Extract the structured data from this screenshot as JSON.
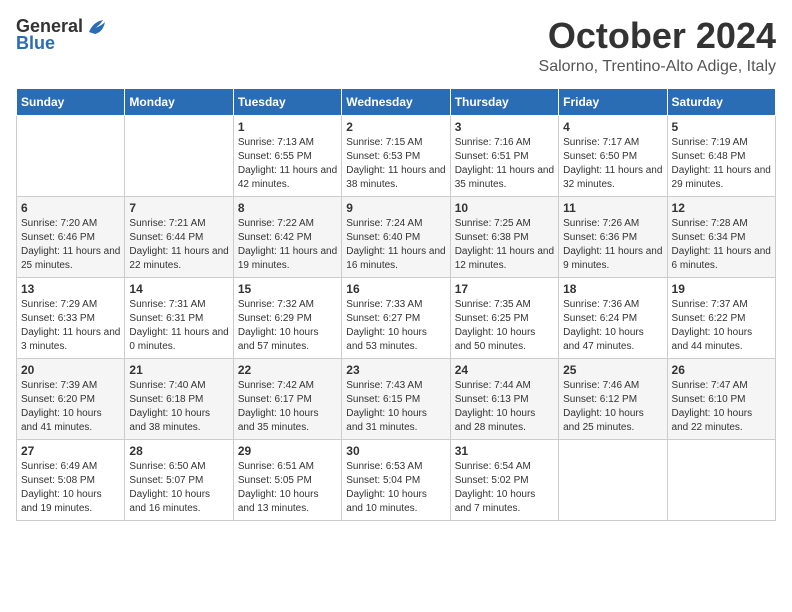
{
  "header": {
    "logo_general": "General",
    "logo_blue": "Blue",
    "month": "October 2024",
    "location": "Salorno, Trentino-Alto Adige, Italy"
  },
  "weekdays": [
    "Sunday",
    "Monday",
    "Tuesday",
    "Wednesday",
    "Thursday",
    "Friday",
    "Saturday"
  ],
  "weeks": [
    [
      {
        "day": "",
        "text": ""
      },
      {
        "day": "",
        "text": ""
      },
      {
        "day": "1",
        "text": "Sunrise: 7:13 AM\nSunset: 6:55 PM\nDaylight: 11 hours and 42 minutes."
      },
      {
        "day": "2",
        "text": "Sunrise: 7:15 AM\nSunset: 6:53 PM\nDaylight: 11 hours and 38 minutes."
      },
      {
        "day": "3",
        "text": "Sunrise: 7:16 AM\nSunset: 6:51 PM\nDaylight: 11 hours and 35 minutes."
      },
      {
        "day": "4",
        "text": "Sunrise: 7:17 AM\nSunset: 6:50 PM\nDaylight: 11 hours and 32 minutes."
      },
      {
        "day": "5",
        "text": "Sunrise: 7:19 AM\nSunset: 6:48 PM\nDaylight: 11 hours and 29 minutes."
      }
    ],
    [
      {
        "day": "6",
        "text": "Sunrise: 7:20 AM\nSunset: 6:46 PM\nDaylight: 11 hours and 25 minutes."
      },
      {
        "day": "7",
        "text": "Sunrise: 7:21 AM\nSunset: 6:44 PM\nDaylight: 11 hours and 22 minutes."
      },
      {
        "day": "8",
        "text": "Sunrise: 7:22 AM\nSunset: 6:42 PM\nDaylight: 11 hours and 19 minutes."
      },
      {
        "day": "9",
        "text": "Sunrise: 7:24 AM\nSunset: 6:40 PM\nDaylight: 11 hours and 16 minutes."
      },
      {
        "day": "10",
        "text": "Sunrise: 7:25 AM\nSunset: 6:38 PM\nDaylight: 11 hours and 12 minutes."
      },
      {
        "day": "11",
        "text": "Sunrise: 7:26 AM\nSunset: 6:36 PM\nDaylight: 11 hours and 9 minutes."
      },
      {
        "day": "12",
        "text": "Sunrise: 7:28 AM\nSunset: 6:34 PM\nDaylight: 11 hours and 6 minutes."
      }
    ],
    [
      {
        "day": "13",
        "text": "Sunrise: 7:29 AM\nSunset: 6:33 PM\nDaylight: 11 hours and 3 minutes."
      },
      {
        "day": "14",
        "text": "Sunrise: 7:31 AM\nSunset: 6:31 PM\nDaylight: 11 hours and 0 minutes."
      },
      {
        "day": "15",
        "text": "Sunrise: 7:32 AM\nSunset: 6:29 PM\nDaylight: 10 hours and 57 minutes."
      },
      {
        "day": "16",
        "text": "Sunrise: 7:33 AM\nSunset: 6:27 PM\nDaylight: 10 hours and 53 minutes."
      },
      {
        "day": "17",
        "text": "Sunrise: 7:35 AM\nSunset: 6:25 PM\nDaylight: 10 hours and 50 minutes."
      },
      {
        "day": "18",
        "text": "Sunrise: 7:36 AM\nSunset: 6:24 PM\nDaylight: 10 hours and 47 minutes."
      },
      {
        "day": "19",
        "text": "Sunrise: 7:37 AM\nSunset: 6:22 PM\nDaylight: 10 hours and 44 minutes."
      }
    ],
    [
      {
        "day": "20",
        "text": "Sunrise: 7:39 AM\nSunset: 6:20 PM\nDaylight: 10 hours and 41 minutes."
      },
      {
        "day": "21",
        "text": "Sunrise: 7:40 AM\nSunset: 6:18 PM\nDaylight: 10 hours and 38 minutes."
      },
      {
        "day": "22",
        "text": "Sunrise: 7:42 AM\nSunset: 6:17 PM\nDaylight: 10 hours and 35 minutes."
      },
      {
        "day": "23",
        "text": "Sunrise: 7:43 AM\nSunset: 6:15 PM\nDaylight: 10 hours and 31 minutes."
      },
      {
        "day": "24",
        "text": "Sunrise: 7:44 AM\nSunset: 6:13 PM\nDaylight: 10 hours and 28 minutes."
      },
      {
        "day": "25",
        "text": "Sunrise: 7:46 AM\nSunset: 6:12 PM\nDaylight: 10 hours and 25 minutes."
      },
      {
        "day": "26",
        "text": "Sunrise: 7:47 AM\nSunset: 6:10 PM\nDaylight: 10 hours and 22 minutes."
      }
    ],
    [
      {
        "day": "27",
        "text": "Sunrise: 6:49 AM\nSunset: 5:08 PM\nDaylight: 10 hours and 19 minutes."
      },
      {
        "day": "28",
        "text": "Sunrise: 6:50 AM\nSunset: 5:07 PM\nDaylight: 10 hours and 16 minutes."
      },
      {
        "day": "29",
        "text": "Sunrise: 6:51 AM\nSunset: 5:05 PM\nDaylight: 10 hours and 13 minutes."
      },
      {
        "day": "30",
        "text": "Sunrise: 6:53 AM\nSunset: 5:04 PM\nDaylight: 10 hours and 10 minutes."
      },
      {
        "day": "31",
        "text": "Sunrise: 6:54 AM\nSunset: 5:02 PM\nDaylight: 10 hours and 7 minutes."
      },
      {
        "day": "",
        "text": ""
      },
      {
        "day": "",
        "text": ""
      }
    ]
  ]
}
